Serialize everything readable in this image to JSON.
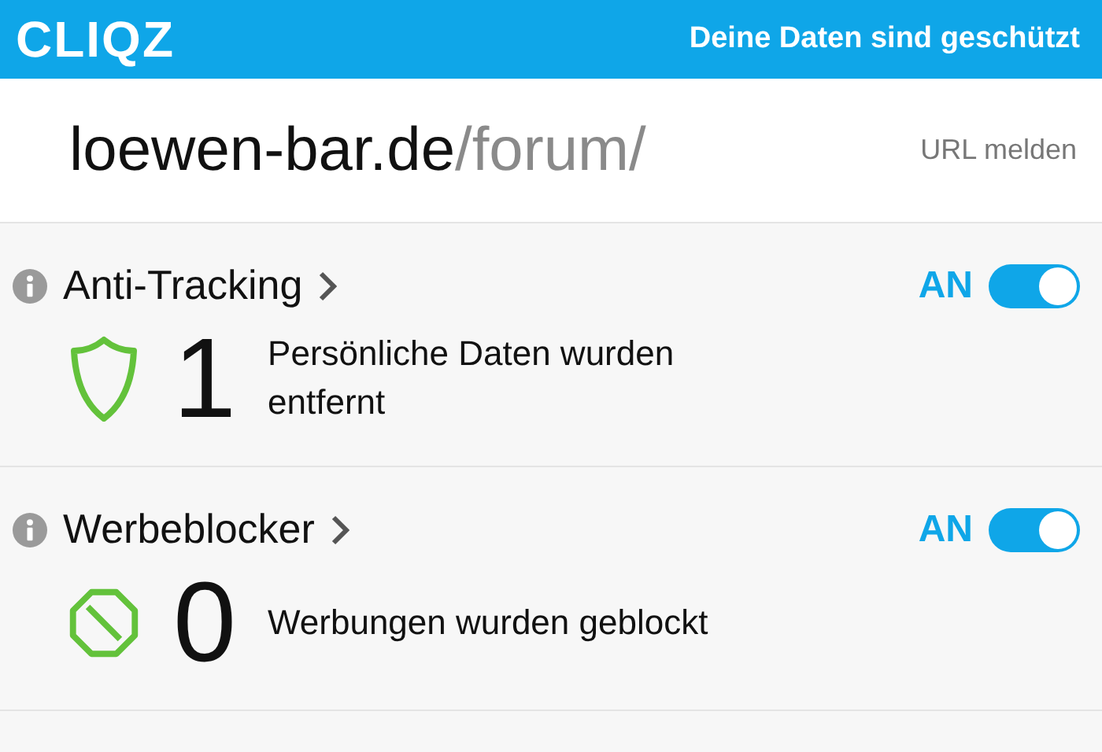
{
  "header": {
    "logo": "CLIQZ",
    "status": "Deine Daten sind geschützt"
  },
  "site": {
    "domain": "loewen-bar.de",
    "path": "/forum/",
    "report_link": "URL melden"
  },
  "modules": [
    {
      "kind": "shield",
      "title": "Anti-Tracking",
      "state_label": "AN",
      "on": true,
      "count": "1",
      "description": "Persönliche Daten wurden entfernt"
    },
    {
      "kind": "block",
      "title": "Werbeblocker",
      "state_label": "AN",
      "on": true,
      "count": "0",
      "description": "Werbungen wurden geblockt"
    }
  ]
}
